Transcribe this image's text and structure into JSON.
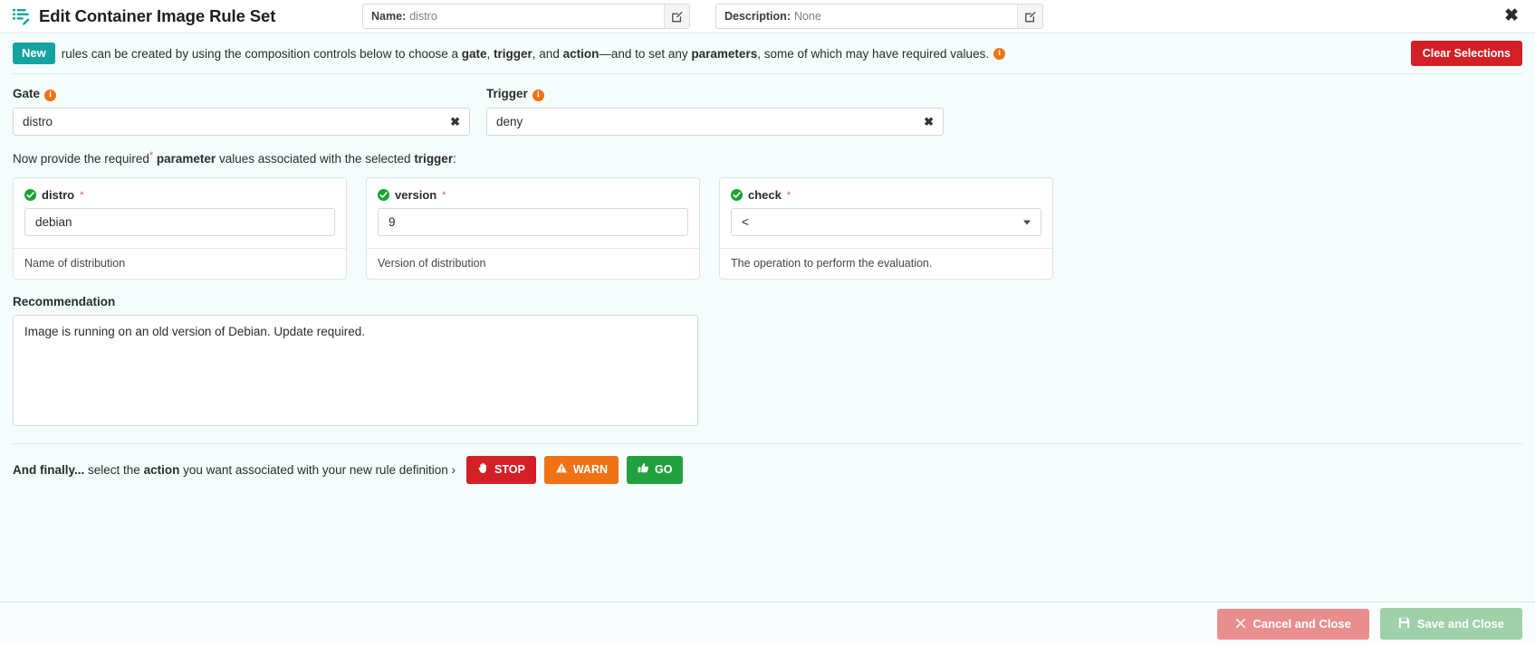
{
  "header": {
    "title": "Edit Container Image Rule Set",
    "title_icon": "edit-list-icon",
    "name_field": {
      "label": "Name:",
      "value": "distro",
      "edit_icon": "pencil-square-icon"
    },
    "description_field": {
      "label": "Description:",
      "value": "None",
      "edit_icon": "pencil-square-icon"
    },
    "close_icon": "close-icon"
  },
  "banner": {
    "badge": "New",
    "text_1": "rules can be created by using the composition controls below to choose a ",
    "bold_gate": "gate",
    "text_2": ", ",
    "bold_trigger": "trigger",
    "text_3": ", and ",
    "bold_action": "action",
    "text_4": "—and to set any ",
    "bold_parameters": "parameters",
    "text_5": ", some of which may have required values.",
    "info_icon": "i",
    "clear_button": "Clear Selections"
  },
  "gate": {
    "label": "Gate",
    "info_icon": "i",
    "value": "distro",
    "clear_icon": "✖"
  },
  "trigger": {
    "label": "Trigger",
    "info_icon": "i",
    "value": "deny",
    "clear_icon": "✖"
  },
  "parameters": {
    "intro_1": "Now provide the required",
    "intro_star": "*",
    "intro_2": " ",
    "intro_bold_parameter": "parameter",
    "intro_3": " values associated with the selected ",
    "intro_bold_trigger": "trigger",
    "intro_4": ":",
    "cards": [
      {
        "name": "distro",
        "required_mark": "*",
        "status_icon": "check-circle-icon",
        "control": "text",
        "value": "debian",
        "description": "Name of distribution"
      },
      {
        "name": "version",
        "required_mark": "*",
        "status_icon": "check-circle-icon",
        "control": "text",
        "value": "9",
        "description": "Version of distribution"
      },
      {
        "name": "check",
        "required_mark": "*",
        "status_icon": "check-circle-icon",
        "control": "select",
        "value": "<",
        "description": "The operation to perform the evaluation."
      }
    ]
  },
  "recommendation": {
    "label": "Recommendation",
    "value": "Image is running on an old version of Debian. Update required.",
    "placeholder": ""
  },
  "action_row": {
    "text_1": "And finally...",
    "text_2": " select the ",
    "bold_action": "action",
    "text_3": " you want associated with your new rule definition ›",
    "buttons": [
      {
        "label": "STOP",
        "icon": "hand-stop-icon",
        "color": "#d32027"
      },
      {
        "label": "WARN",
        "icon": "warning-triangle-icon",
        "color": "#ef7215"
      },
      {
        "label": "GO",
        "icon": "thumbs-up-icon",
        "color": "#22a03f"
      }
    ]
  },
  "footer": {
    "cancel_label": "Cancel and Close",
    "cancel_icon": "close-icon",
    "save_label": "Save and Close",
    "save_icon": "floppy-disk-icon"
  },
  "colors": {
    "teal_badge": "#15a3a0",
    "red": "#d32027",
    "orange": "#ef7215",
    "green": "#22a03f",
    "page_bg": "#f5fcfc"
  }
}
